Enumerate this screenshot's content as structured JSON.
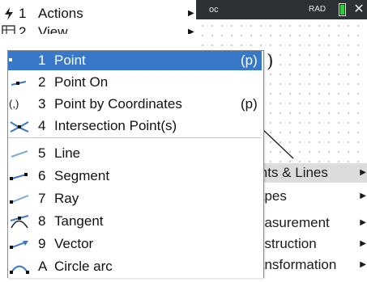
{
  "status_bar": {
    "doc_tab": "oc",
    "angle_mode": "RAD"
  },
  "canvas": {
    "label": "1)"
  },
  "menu": {
    "items": [
      {
        "num": "1",
        "label": "Actions",
        "icon": "bolt-icon",
        "has_submenu": true
      },
      {
        "num": "2",
        "label": "View",
        "icon": "view-icon",
        "has_submenu": true
      }
    ]
  },
  "points_lines_submenu": {
    "items": [
      {
        "num": "1",
        "label": "Point",
        "shortcut": "(p)",
        "icon": "point-icon",
        "selected": true
      },
      {
        "num": "2",
        "label": "Point On",
        "shortcut": "",
        "icon": "point-on-icon"
      },
      {
        "num": "3",
        "label": "Point by Coordinates",
        "shortcut": "(p)",
        "icon": "point-coordinates-icon",
        "icon_text": "(,)"
      },
      {
        "num": "4",
        "label": "Intersection Point(s)",
        "shortcut": "",
        "icon": "intersection-icon"
      },
      {
        "num": "5",
        "label": "Line",
        "shortcut": "",
        "icon": "line-icon"
      },
      {
        "num": "6",
        "label": "Segment",
        "shortcut": "",
        "icon": "segment-icon"
      },
      {
        "num": "7",
        "label": "Ray",
        "shortcut": "",
        "icon": "ray-icon"
      },
      {
        "num": "8",
        "label": "Tangent",
        "shortcut": "",
        "icon": "tangent-icon"
      },
      {
        "num": "9",
        "label": "Vector",
        "shortcut": "",
        "icon": "vector-icon"
      },
      {
        "num": "A",
        "label": "Circle arc",
        "shortcut": "",
        "icon": "circle-arc-icon"
      }
    ]
  },
  "geometry_submenu": {
    "items": [
      {
        "label": "ints & Lines"
      },
      {
        "label": "apes"
      },
      {
        "label": "easurement"
      },
      {
        "label": "nstruction"
      },
      {
        "label": "ansformation"
      }
    ]
  },
  "colors": {
    "selection": "#3878c8",
    "top_bar": "#2c3136",
    "battery": "#2ecc40",
    "icon_blue": "#3a78c8"
  }
}
